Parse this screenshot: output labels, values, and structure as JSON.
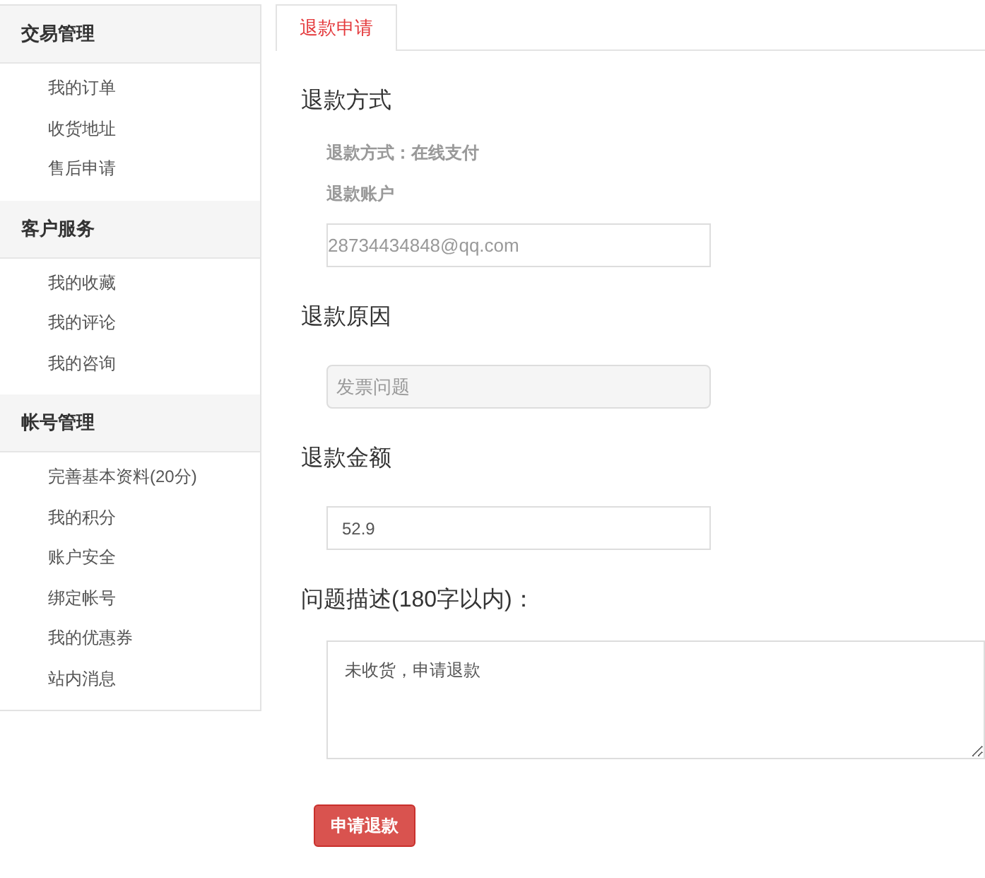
{
  "sidebar": {
    "groups": [
      {
        "title": "交易管理",
        "items": [
          "我的订单",
          "收货地址",
          "售后申请"
        ]
      },
      {
        "title": "客户服务",
        "items": [
          "我的收藏",
          "我的评论",
          "我的咨询"
        ]
      },
      {
        "title": "帐号管理",
        "items": [
          "完善基本资料(20分)",
          "我的积分",
          "账户安全",
          "绑定帐号",
          "我的优惠券",
          "站内消息"
        ]
      }
    ]
  },
  "tabs": [
    {
      "label": "退款申请",
      "selected": true
    }
  ],
  "sections": [
    {
      "heading": "退款方式",
      "notes": [
        "退款方式：在线支付",
        "退款账户"
      ],
      "field": {
        "kind": "input",
        "placeholder": "28734434848@qq.com",
        "disabled": false
      }
    },
    {
      "heading": "退款原因",
      "field": {
        "kind": "input",
        "placeholder": "发票问题",
        "disabled": true
      }
    },
    {
      "heading": "退款金额",
      "field": {
        "kind": "input",
        "value": "52.9",
        "disabled": false
      }
    },
    {
      "heading": "问题描述(180字以内)：",
      "field": {
        "kind": "textarea",
        "value": "未收货，申请退款",
        "disabled": false
      }
    }
  ],
  "submit_button": "申请退款"
}
